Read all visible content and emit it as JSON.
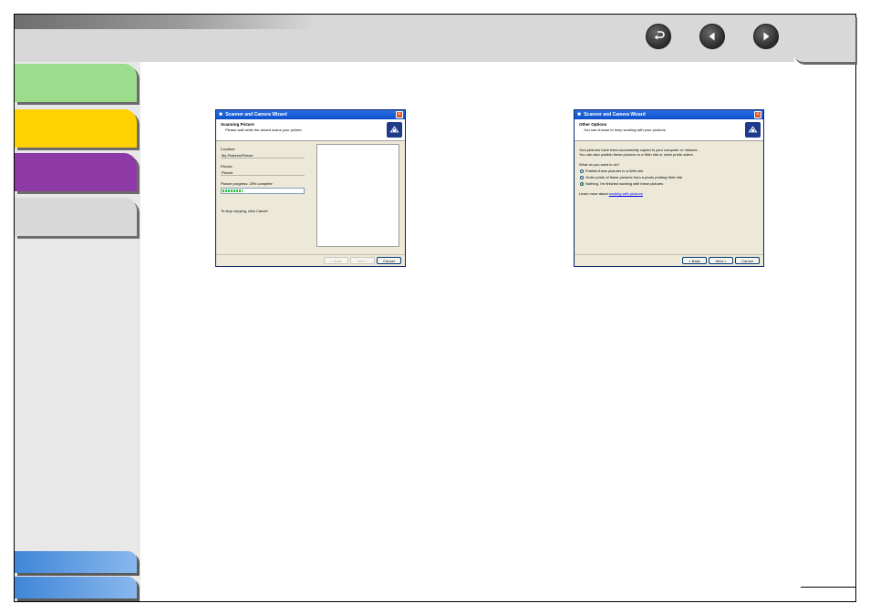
{
  "nav": {
    "back_icon": "return-icon",
    "prev_icon": "arrow-left-icon",
    "next_icon": "arrow-right-icon"
  },
  "sidebar": {
    "tabs": [
      {
        "color": "#9bdc8d"
      },
      {
        "color": "#ffd100"
      },
      {
        "color": "#8e3aa6"
      },
      {
        "color": "#d8d8d8"
      }
    ],
    "bottom_tabs": [
      {
        "color": "#3f86d6"
      },
      {
        "color": "#3f86d6"
      }
    ]
  },
  "dialog_scan": {
    "title": "Scanner and Camera Wizard",
    "header_title": "Scanning Picture",
    "header_sub": "Please wait while the wizard scans your picture.",
    "location_label": "Location:",
    "location_value": "My Pictures\\Picture",
    "picture_label": "Picture:",
    "picture_value": "Picture",
    "progress_label": "Picture progress: 25% complete",
    "progress": 0.25,
    "stop_text": "To stop copying, click Cancel.",
    "back_btn": "< Back",
    "next_btn": "Next >",
    "cancel_btn": "Cancel"
  },
  "dialog_options": {
    "title": "Scanner and Camera Wizard",
    "header_title": "Other Options",
    "header_sub": "You can choose to keep working with your pictures.",
    "para1": "Your pictures have been successfully copied to your computer or network.",
    "para2": "You can also publish these pictures to a Web site or order prints online.",
    "question": "What do you want to do?",
    "options": [
      "Publish these pictures to a Web site",
      "Order prints of these pictures from a photo printing Web site",
      "Nothing. I'm finished working with these pictures"
    ],
    "selected_option": 2,
    "learn_prefix": "Learn more about ",
    "learn_link": "working with pictures",
    "back_btn": "< Back",
    "next_btn": "Next >",
    "cancel_btn": "Cancel"
  }
}
